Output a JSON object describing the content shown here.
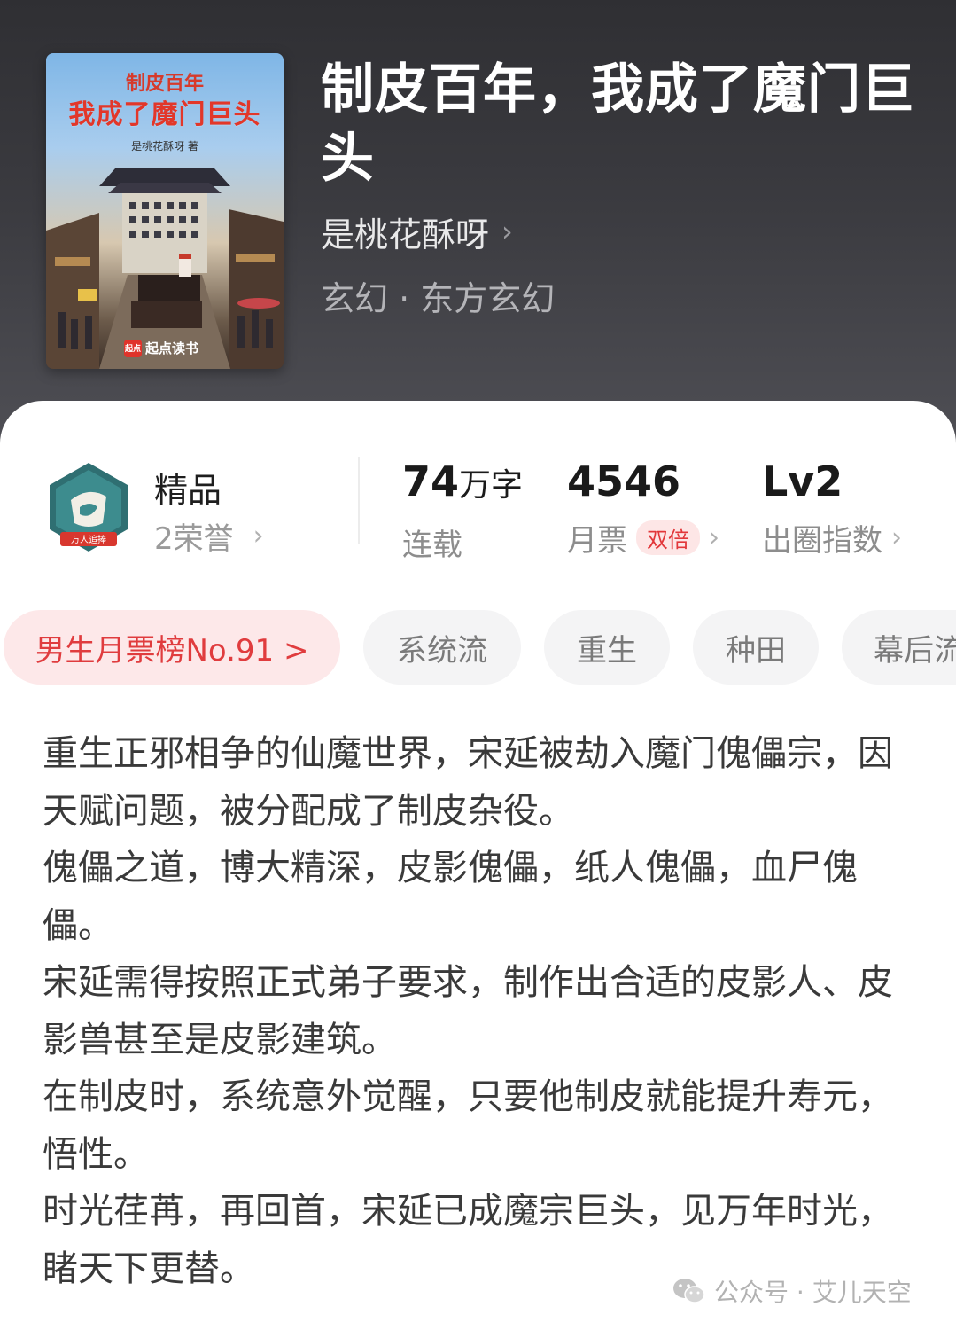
{
  "book": {
    "title": "制皮百年，我成了魔门巨头",
    "author": "是桃花酥呀",
    "genre": "玄幻 · 东方玄幻"
  },
  "cover": {
    "title_line1": "制皮百年",
    "title_line2": "我成了魔门巨头",
    "author_line": "是桃花酥呀 著",
    "brand_badge": "起点",
    "brand": "起点读书"
  },
  "badge": {
    "emblem_text": "万人追捧",
    "label": "精品",
    "honor": "2荣誉"
  },
  "stats": {
    "words_value": "74",
    "words_unit": "万字",
    "words_label": "连载",
    "tickets_value": "4546",
    "tickets_label": "月票",
    "tickets_badge": "双倍",
    "level_value": "Lv2",
    "level_label": "出圈指数"
  },
  "tags": {
    "rank": "男生月票榜No.91 >",
    "items": [
      "系统流",
      "重生",
      "种田",
      "幕后流"
    ]
  },
  "description": [
    "重生正邪相争的仙魔世界，宋延被劫入魔门傀儡宗，因天赋问题，被分配成了制皮杂役。",
    "傀儡之道，博大精深，皮影傀儡，纸人傀儡，血尸傀儡。",
    "宋延需得按照正式弟子要求，制作出合适的皮影人、皮影兽甚至是皮影建筑。",
    "在制皮时，系统意外觉醒，只要他制皮就能提升寿元，悟性。",
    "时光荏苒，再回首，宋延已成魔宗巨头，见万年时光，睹天下更替。"
  ],
  "watermark": "公众号 · 艾儿天空",
  "icons": {
    "chevron": "chevron-right-icon",
    "wechat": "wechat-icon"
  }
}
